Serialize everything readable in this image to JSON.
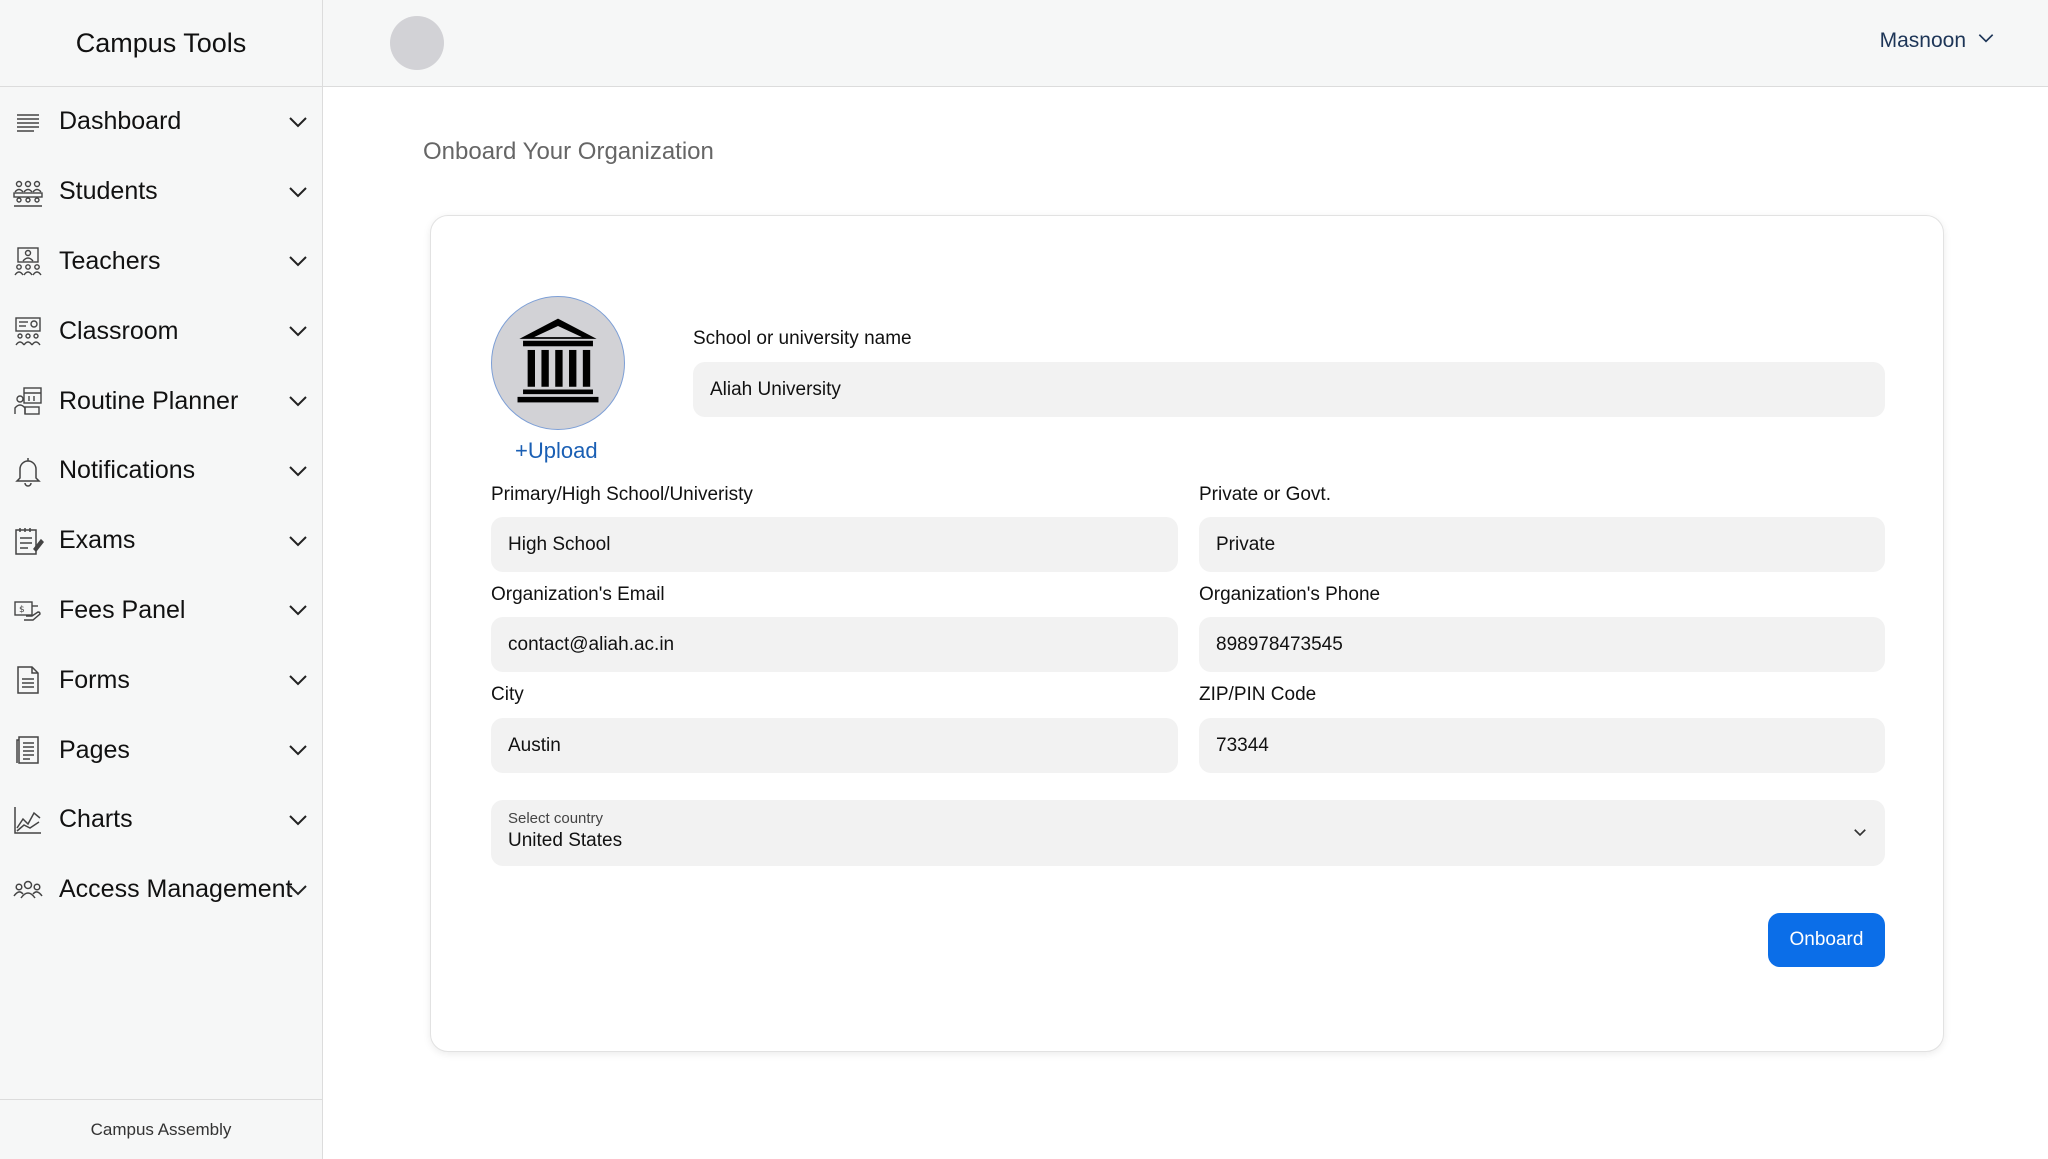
{
  "app": {
    "title": "Campus Tools",
    "footer": "Campus Assembly"
  },
  "sidebar": {
    "items": [
      {
        "label": "Dashboard",
        "icon": "list-icon"
      },
      {
        "label": "Students",
        "icon": "students-icon"
      },
      {
        "label": "Teachers",
        "icon": "teachers-icon"
      },
      {
        "label": "Classroom",
        "icon": "classroom-icon"
      },
      {
        "label": "Routine Planner",
        "icon": "routine-planner-icon"
      },
      {
        "label": "Notifications",
        "icon": "bell-icon"
      },
      {
        "label": "Exams",
        "icon": "exam-icon"
      },
      {
        "label": "Fees Panel",
        "icon": "fees-icon"
      },
      {
        "label": "Forms",
        "icon": "form-document-icon"
      },
      {
        "label": "Pages",
        "icon": "pages-icon"
      },
      {
        "label": "Charts",
        "icon": "chart-icon"
      },
      {
        "label": "Access Management",
        "icon": "users-group-icon"
      }
    ]
  },
  "topbar": {
    "user_name": "Masnoon"
  },
  "main": {
    "page_title": "Onboard Your Organization"
  },
  "form": {
    "upload_label": "+Upload",
    "school_name": {
      "label": "School or university name",
      "value": "Aliah University"
    },
    "institution_type": {
      "label": "Primary/High School/Univeristy",
      "value": "High School"
    },
    "ownership": {
      "label": "Private or Govt.",
      "value": "Private"
    },
    "email": {
      "label": "Organization's Email",
      "value": "contact@aliah.ac.in"
    },
    "phone": {
      "label": "Organization's Phone",
      "value": "898978473545"
    },
    "city": {
      "label": "City",
      "value": "Austin"
    },
    "zip": {
      "label": "ZIP/PIN Code",
      "value": "73344"
    },
    "country": {
      "caption": "Select country",
      "value": "United States"
    },
    "submit_label": "Onboard"
  },
  "colors": {
    "accent": "#0b6ee8",
    "link": "#1a5fb4",
    "input_bg": "#f2f2f2",
    "sidebar_bg": "#f6f7f7"
  }
}
